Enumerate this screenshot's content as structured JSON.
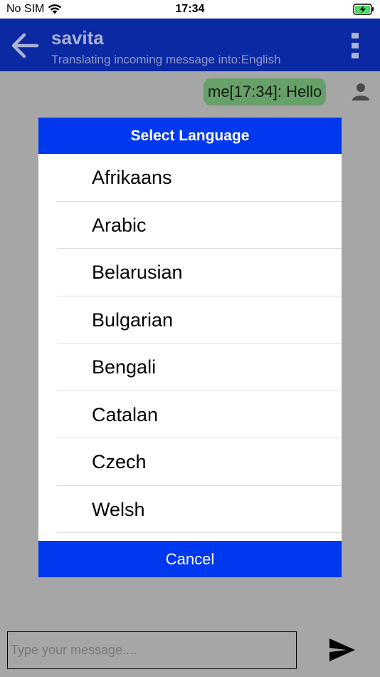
{
  "status_bar": {
    "carrier": "No SIM",
    "time": "17:34",
    "wifi_icon": "wifi-icon",
    "battery_icon": "battery-charging-icon"
  },
  "app_bar": {
    "back_icon": "arrow-left-icon",
    "contact_name": "savita",
    "subtitle": "Translating incoming message into:English",
    "menu_icon": "more-vertical-icon",
    "background_color": "#0a29a2"
  },
  "chat": {
    "messages": [
      {
        "text": "me[17:34]: Hello",
        "bubble_color": "#68a06a"
      }
    ],
    "avatar_icon": "person-icon"
  },
  "dialog": {
    "title": "Select Language",
    "languages": [
      "Afrikaans",
      "Arabic",
      "Belarusian",
      "Bulgarian",
      "Bengali",
      "Catalan",
      "Czech",
      "Welsh"
    ],
    "cancel_label": "Cancel",
    "accent_color": "#0038f0"
  },
  "composer": {
    "placeholder": "Type your message....",
    "value": "",
    "send_icon": "send-icon"
  }
}
